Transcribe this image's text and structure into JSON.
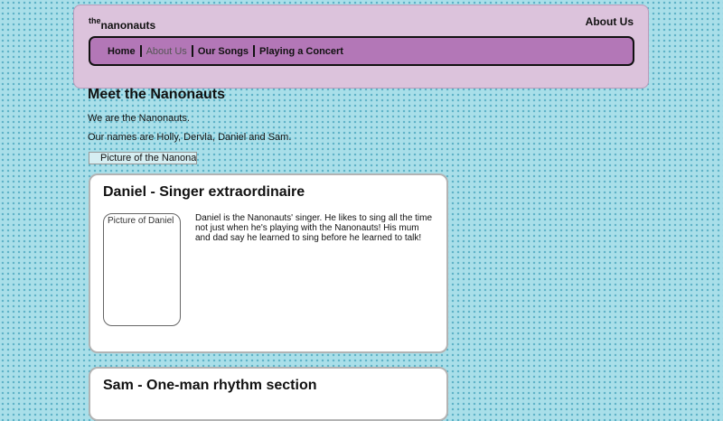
{
  "header": {
    "logo_prefix": "the",
    "logo_name": "nanonauts",
    "current_page": "About Us"
  },
  "nav": {
    "items": [
      {
        "label": "Home",
        "active": false
      },
      {
        "label": "About Us",
        "active": true
      },
      {
        "label": "Our Songs",
        "active": false
      },
      {
        "label": "Playing a Concert",
        "active": false
      }
    ]
  },
  "main": {
    "title": "Meet the Nanonauts",
    "intro": "We are the Nanonauts.",
    "names": "Our names are Holly, Dervla, Daniel and Sam.",
    "group_image_alt": "Picture of the Nanonauts"
  },
  "cards": [
    {
      "title": "Daniel - Singer extraordinaire",
      "image_alt": "Picture of Daniel",
      "text": "Daniel is the Nanonauts' singer. He likes to sing all the time not just when he's playing with the Nanonauts! His mum and dad say he learned to sing before he learned to talk!"
    },
    {
      "title": "Sam - One-man rhythm section"
    }
  ]
}
